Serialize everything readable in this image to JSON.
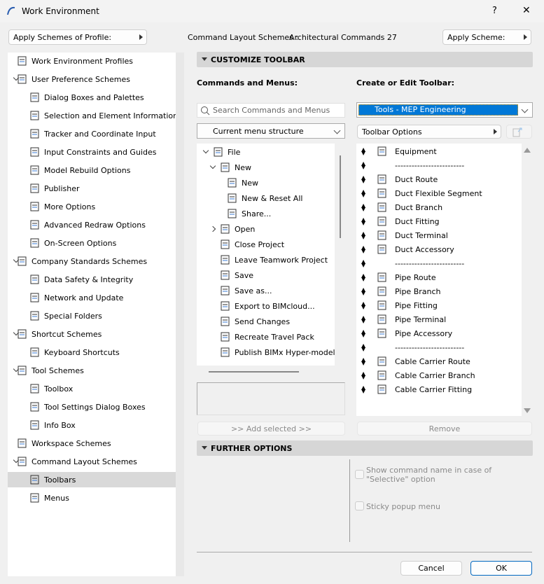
{
  "window": {
    "title": "Work Environment",
    "help": "?",
    "close": "✕"
  },
  "top": {
    "apply_profile": "Apply Schemes of Profile:",
    "scheme_label": "Command Layout Schemes :",
    "scheme_value": "Architectural Commands 27",
    "apply_scheme": "Apply Scheme:"
  },
  "tree": [
    {
      "label": "Work Environment Profiles",
      "level": 0,
      "chev": false
    },
    {
      "label": "User Preference Schemes",
      "level": 0,
      "chev": true
    },
    {
      "label": "Dialog Boxes and Palettes",
      "level": 1
    },
    {
      "label": "Selection and Element Information",
      "level": 1
    },
    {
      "label": "Tracker and Coordinate Input",
      "level": 1
    },
    {
      "label": "Input Constraints and Guides",
      "level": 1
    },
    {
      "label": "Model Rebuild Options",
      "level": 1
    },
    {
      "label": "Publisher",
      "level": 1
    },
    {
      "label": "More Options",
      "level": 1
    },
    {
      "label": "Advanced Redraw Options",
      "level": 1
    },
    {
      "label": "On-Screen Options",
      "level": 1
    },
    {
      "label": "Company Standards Schemes",
      "level": 0,
      "chev": true
    },
    {
      "label": "Data Safety & Integrity",
      "level": 1
    },
    {
      "label": "Network and Update",
      "level": 1
    },
    {
      "label": "Special Folders",
      "level": 1
    },
    {
      "label": "Shortcut Schemes",
      "level": 0,
      "chev": true
    },
    {
      "label": "Keyboard Shortcuts",
      "level": 1
    },
    {
      "label": "Tool Schemes",
      "level": 0,
      "chev": true
    },
    {
      "label": "Toolbox",
      "level": 1
    },
    {
      "label": "Tool Settings Dialog Boxes",
      "level": 1
    },
    {
      "label": "Info Box",
      "level": 1
    },
    {
      "label": "Workspace Schemes",
      "level": 0,
      "chev": false
    },
    {
      "label": "Command Layout Schemes",
      "level": 0,
      "chev": true
    },
    {
      "label": "Toolbars",
      "level": 1,
      "selected": true
    },
    {
      "label": "Menus",
      "level": 1
    }
  ],
  "customize": {
    "title": "CUSTOMIZE TOOLBAR",
    "commands_label": "Commands and Menus:",
    "toolbar_label": "Create or Edit Toolbar:",
    "search_placeholder": "Search Commands and Menus",
    "menu_structure": "Current menu structure",
    "toolbar_select": "Tools - MEP Engineering",
    "toolbar_options": "Toolbar Options",
    "add_selected": ">> Add selected >>",
    "remove": "Remove"
  },
  "menu_tree": [
    {
      "label": "File",
      "level": 0,
      "chev": "down"
    },
    {
      "label": "New",
      "level": 1,
      "chev": "down"
    },
    {
      "label": "New",
      "level": 2
    },
    {
      "label": "New & Reset All",
      "level": 2
    },
    {
      "label": "Share...",
      "level": 2
    },
    {
      "label": "Open",
      "level": 1,
      "chev": "right"
    },
    {
      "label": "Close Project",
      "level": 1
    },
    {
      "label": "Leave Teamwork Project",
      "level": 1
    },
    {
      "label": "Save",
      "level": 1
    },
    {
      "label": "Save as...",
      "level": 1
    },
    {
      "label": "Export to BIMcloud...",
      "level": 1
    },
    {
      "label": "Send Changes",
      "level": 1
    },
    {
      "label": "Recreate Travel Pack",
      "level": 1
    },
    {
      "label": "Publish BIMx Hyper-model...",
      "level": 1
    }
  ],
  "toolbar_items": [
    "Equipment",
    "-------------------------",
    "Duct Route",
    "Duct Flexible Segment",
    "Duct Branch",
    "Duct Fitting",
    "Duct Terminal",
    "Duct Accessory",
    "-------------------------",
    "Pipe Route",
    "Pipe Branch",
    "Pipe Fitting",
    "Pipe Terminal",
    "Pipe Accessory",
    "-------------------------",
    "Cable Carrier Route",
    "Cable Carrier Branch",
    "Cable Carrier Fitting"
  ],
  "further": {
    "title": "FURTHER OPTIONS",
    "show_name": "Show command name in case of \"Selective\" option",
    "sticky": "Sticky popup menu"
  },
  "footer": {
    "cancel": "Cancel",
    "ok": "OK"
  },
  "colors": {
    "accent": "#0078d7",
    "selected_row": "#d9d9d9"
  }
}
